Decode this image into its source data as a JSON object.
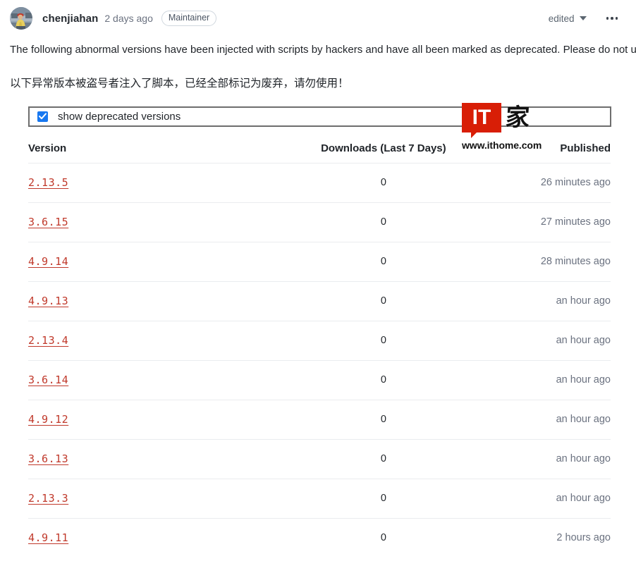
{
  "comment": {
    "author": "chenjiahan",
    "timestamp": "2 days ago",
    "role_badge": "Maintainer",
    "edited_label": "edited",
    "more_menu_icon": "kebab-horizontal-icon",
    "avatar_alt": "chenjiahan avatar"
  },
  "body": {
    "paragraph_en": "The following abnormal versions have been injected with scripts by hackers and have all been marked as deprecated. Please do not use them!",
    "paragraph_zh": "以下异常版本被盗号者注入了脚本，已经全部标记为废弃，请勿使用！"
  },
  "watermark": {
    "brand_mark": "IT",
    "brand_cjk": "家",
    "url": "www.ithome.com",
    "brand_color": "#d81e06"
  },
  "deprecated_toggle": {
    "label": "show deprecated versions",
    "checked": true,
    "checkbox_color": "#1878f0"
  },
  "versions_table": {
    "columns": {
      "version": "Version",
      "downloads": "Downloads (Last 7 Days)",
      "published": "Published"
    },
    "rows": [
      {
        "version": "2.13.5",
        "downloads": "0",
        "published": "26 minutes ago"
      },
      {
        "version": "3.6.15",
        "downloads": "0",
        "published": "27 minutes ago"
      },
      {
        "version": "4.9.14",
        "downloads": "0",
        "published": "28 minutes ago"
      },
      {
        "version": "4.9.13",
        "downloads": "0",
        "published": "an hour ago"
      },
      {
        "version": "2.13.4",
        "downloads": "0",
        "published": "an hour ago"
      },
      {
        "version": "3.6.14",
        "downloads": "0",
        "published": "an hour ago"
      },
      {
        "version": "4.9.12",
        "downloads": "0",
        "published": "an hour ago"
      },
      {
        "version": "3.6.13",
        "downloads": "0",
        "published": "an hour ago"
      },
      {
        "version": "2.13.3",
        "downloads": "0",
        "published": "an hour ago"
      },
      {
        "version": "4.9.11",
        "downloads": "0",
        "published": "2 hours ago"
      }
    ],
    "link_color": "#c0392b"
  }
}
